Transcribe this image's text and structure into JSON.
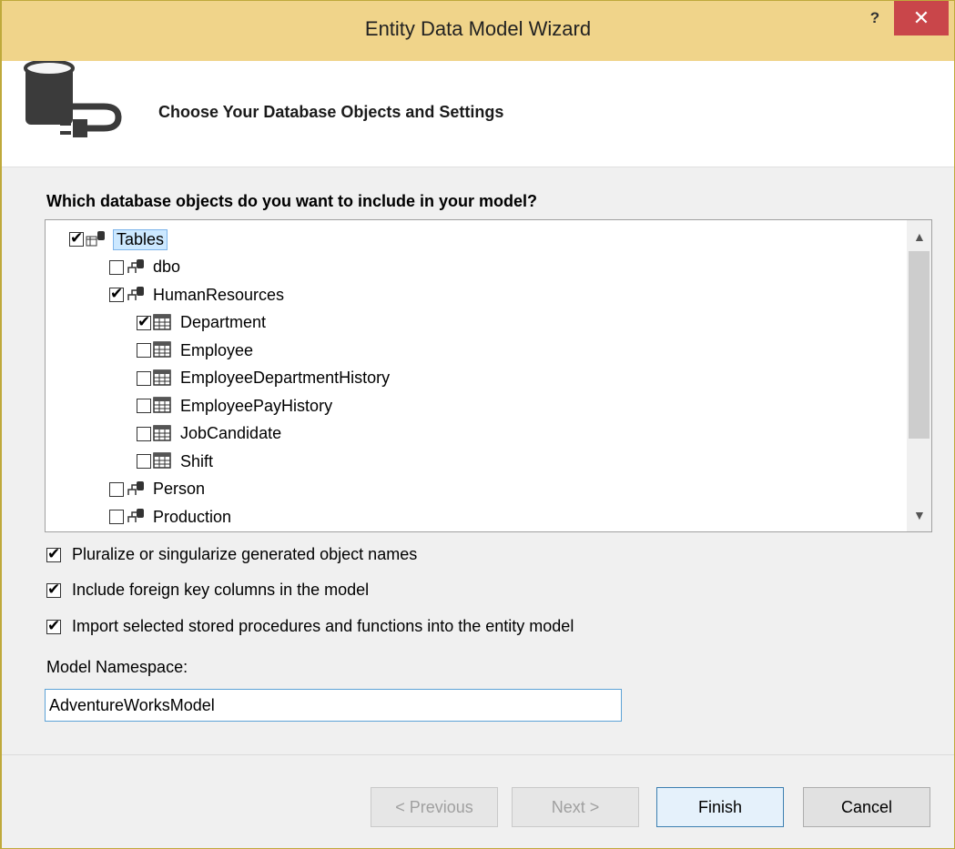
{
  "window": {
    "title": "Entity Data Model Wizard",
    "help_label": "?",
    "close_label": "✕"
  },
  "header": {
    "heading": "Choose Your Database Objects and Settings"
  },
  "question": "Which database objects do you want to include in your model?",
  "tree": [
    {
      "label": "Tables",
      "checked": true,
      "level": 0,
      "icon": "tables-icon",
      "selected": true
    },
    {
      "label": "dbo",
      "checked": false,
      "level": 1,
      "icon": "schema-icon"
    },
    {
      "label": "HumanResources",
      "checked": true,
      "level": 1,
      "icon": "schema-icon"
    },
    {
      "label": "Department",
      "checked": true,
      "level": 2,
      "icon": "table-icon"
    },
    {
      "label": "Employee",
      "checked": false,
      "level": 2,
      "icon": "table-icon"
    },
    {
      "label": "EmployeeDepartmentHistory",
      "checked": false,
      "level": 2,
      "icon": "table-icon"
    },
    {
      "label": "EmployeePayHistory",
      "checked": false,
      "level": 2,
      "icon": "table-icon"
    },
    {
      "label": "JobCandidate",
      "checked": false,
      "level": 2,
      "icon": "table-icon"
    },
    {
      "label": "Shift",
      "checked": false,
      "level": 2,
      "icon": "table-icon"
    },
    {
      "label": "Person",
      "checked": false,
      "level": 1,
      "icon": "schema-icon"
    },
    {
      "label": "Production",
      "checked": false,
      "level": 1,
      "icon": "schema-icon"
    }
  ],
  "options": [
    {
      "label": "Pluralize or singularize generated object names",
      "checked": true
    },
    {
      "label": "Include foreign key columns in the model",
      "checked": true
    },
    {
      "label": "Import selected stored procedures and functions into the entity model",
      "checked": true
    }
  ],
  "namespace": {
    "label": "Model Namespace:",
    "value": "AdventureWorksModel"
  },
  "buttons": {
    "previous": "< Previous",
    "next": "Next >",
    "finish": "Finish",
    "cancel": "Cancel"
  }
}
